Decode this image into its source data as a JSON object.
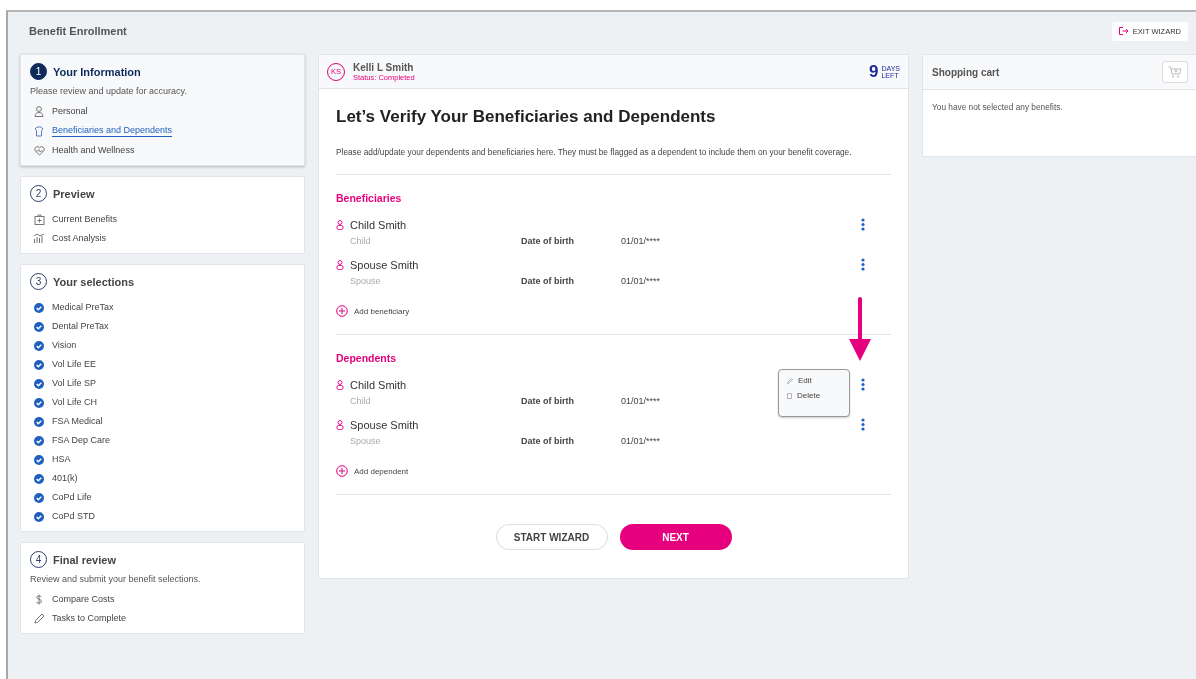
{
  "header": {
    "title": "Benefit Enrollment",
    "exit_button": "EXIT WIZARD"
  },
  "steps": [
    {
      "number": "1",
      "title": "Your Information",
      "selected": true,
      "description": "Please review and update for accuracy.",
      "items": [
        {
          "label": "Personal",
          "kind": "person",
          "selected": false
        },
        {
          "label": "Beneficiaries and Dependents",
          "kind": "shirt",
          "selected": true
        },
        {
          "label": "Health and Wellness",
          "kind": "heart",
          "selected": false
        }
      ]
    },
    {
      "number": "2",
      "title": "Preview",
      "selected": false,
      "items": [
        {
          "label": "Current Benefits",
          "kind": "case",
          "selected": false
        },
        {
          "label": "Cost Analysis",
          "kind": "chart",
          "selected": false
        }
      ]
    },
    {
      "number": "3",
      "title": "Your selections",
      "selected": false,
      "items": [
        {
          "label": "Medical PreTax",
          "kind": "check",
          "selected": false
        },
        {
          "label": "Dental PreTax",
          "kind": "check",
          "selected": false
        },
        {
          "label": "Vision",
          "kind": "check",
          "selected": false
        },
        {
          "label": "Vol Life EE",
          "kind": "check",
          "selected": false
        },
        {
          "label": "Vol Life SP",
          "kind": "check",
          "selected": false
        },
        {
          "label": "Vol Life CH",
          "kind": "check",
          "selected": false
        },
        {
          "label": "FSA Medical",
          "kind": "check",
          "selected": false
        },
        {
          "label": "FSA Dep Care",
          "kind": "check",
          "selected": false
        },
        {
          "label": "HSA",
          "kind": "check",
          "selected": false
        },
        {
          "label": "401(k)",
          "kind": "check",
          "selected": false
        },
        {
          "label": "CoPd Life",
          "kind": "check",
          "selected": false
        },
        {
          "label": "CoPd STD",
          "kind": "check",
          "selected": false
        }
      ]
    },
    {
      "number": "4",
      "title": "Final review",
      "selected": false,
      "description": "Review and submit your benefit selections.",
      "items": [
        {
          "label": "Compare Costs",
          "kind": "dollar",
          "selected": false
        },
        {
          "label": "Tasks to Complete",
          "kind": "pencil",
          "selected": false
        }
      ]
    }
  ],
  "employee": {
    "initials": "KS",
    "name": "Kelli L Smith",
    "status": "Status: Completed",
    "days": "9",
    "days_unit": [
      "DAYS",
      "LEFT"
    ]
  },
  "main": {
    "heading": "Let’s Verify Your Beneficiaries and Dependents",
    "intro": "Please add/update your dependents and beneficiaries here. They must be flagged as a dependent to include them on your benefit coverage.",
    "sections": [
      {
        "title": "Beneficiaries",
        "add_label": "Add beneficiary",
        "people": [
          {
            "name": "Child Smith",
            "relation": "Child",
            "dob_label": "Date of birth",
            "dob": "01/01/****",
            "menu_open": false
          },
          {
            "name": "Spouse Smith",
            "relation": "Spouse",
            "dob_label": "Date of birth",
            "dob": "01/01/****",
            "menu_open": false
          }
        ]
      },
      {
        "title": "Dependents",
        "add_label": "Add dependent",
        "people": [
          {
            "name": "Child Smith",
            "relation": "Child",
            "dob_label": "Date of birth",
            "dob": "01/01/****",
            "menu_open": true
          },
          {
            "name": "Spouse Smith",
            "relation": "Spouse",
            "dob_label": "Date of birth",
            "dob": "01/01/****",
            "menu_open": false
          }
        ]
      }
    ],
    "menu_items": [
      "Edit",
      "Delete"
    ],
    "buttons": {
      "secondary": "START WIZARD",
      "primary": "NEXT"
    }
  },
  "cart": {
    "title": "Shopping cart",
    "empty_text": "You have not selected any benefits."
  }
}
